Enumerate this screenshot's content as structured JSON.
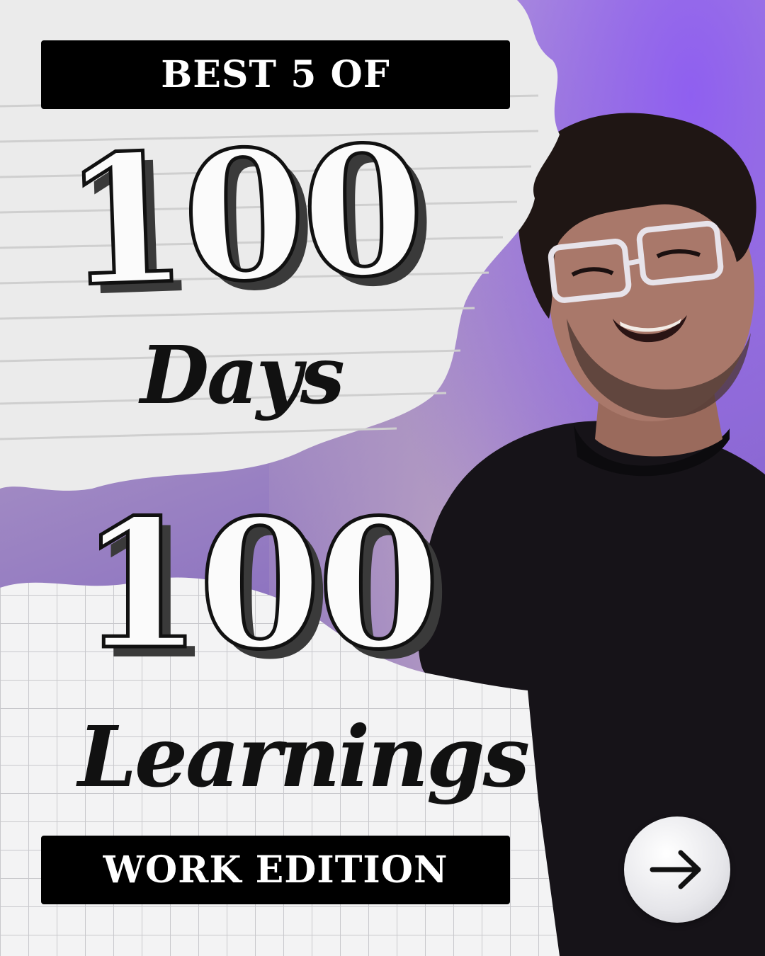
{
  "header_label": "BEST 5 OF",
  "first_number": "100",
  "first_word": "Days",
  "second_number": "100",
  "second_word": "Learnings",
  "footer_label": "WORK EDITION",
  "next_button_icon": "arrow-right-icon",
  "colors": {
    "background_purple": "#8a6fc0",
    "label_black": "#000000",
    "label_text": "#ffffff"
  }
}
